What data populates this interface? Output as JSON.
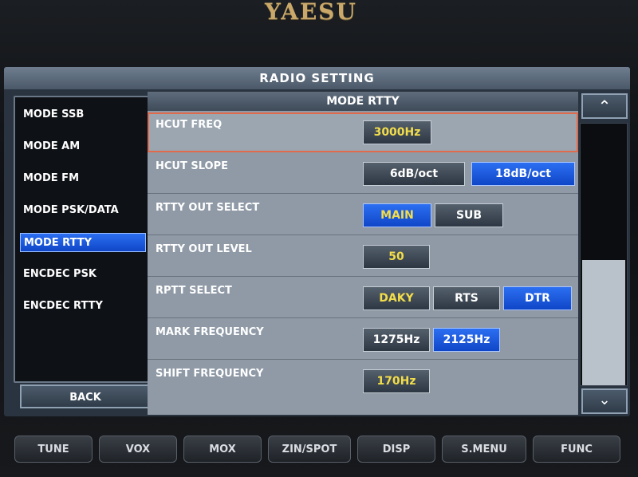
{
  "device": {
    "brand": "YAESU"
  },
  "screen": {
    "title": "RADIO SETTING"
  },
  "sidebar": {
    "items": [
      {
        "label": "MODE SSB",
        "selected": false
      },
      {
        "label": "MODE AM",
        "selected": false
      },
      {
        "label": "MODE FM",
        "selected": false
      },
      {
        "label": "MODE PSK/DATA",
        "selected": false
      },
      {
        "label": "MODE RTTY",
        "selected": true
      },
      {
        "label": "ENCDEC PSK",
        "selected": false
      },
      {
        "label": "ENCDEC RTTY",
        "selected": false
      }
    ],
    "back_label": "BACK"
  },
  "main": {
    "header": "MODE RTTY",
    "settings": [
      {
        "label": "HCUT FREQ",
        "options": [
          {
            "label": "3000Hz",
            "active": false
          }
        ]
      },
      {
        "label": "HCUT SLOPE",
        "options": [
          {
            "label": "6dB/oct",
            "active": false
          },
          {
            "label": "18dB/oct",
            "active": true
          }
        ]
      },
      {
        "label": "RTTY OUT SELECT",
        "options": [
          {
            "label": "MAIN",
            "active": true
          },
          {
            "label": "SUB",
            "active": false
          }
        ]
      },
      {
        "label": "RTTY OUT LEVEL",
        "options": [
          {
            "label": "50",
            "active": false
          }
        ]
      },
      {
        "label": "RPTT SELECT",
        "options": [
          {
            "label": "DAKY",
            "active": false
          },
          {
            "label": "RTS",
            "active": false
          },
          {
            "label": "DTR",
            "active": true
          }
        ]
      },
      {
        "label": "MARK FREQUENCY",
        "options": [
          {
            "label": "1275Hz",
            "active": false
          },
          {
            "label": "2125Hz",
            "active": true
          }
        ]
      },
      {
        "label": "SHIFT FREQUENCY",
        "options": [
          {
            "label": "170Hz",
            "active": false
          }
        ]
      }
    ]
  },
  "scrollbar": {
    "position": 0.0,
    "visible_fraction": 0.48
  },
  "hardware_buttons": [
    "TUNE",
    "VOX",
    "MOX",
    "ZIN/SPOT",
    "DISP",
    "S.MENU",
    "FUNC"
  ],
  "colors": {
    "active_blue": "#1155e6",
    "value_yellow": "#f2dd4a",
    "selection_outline": "#e06a4c"
  }
}
